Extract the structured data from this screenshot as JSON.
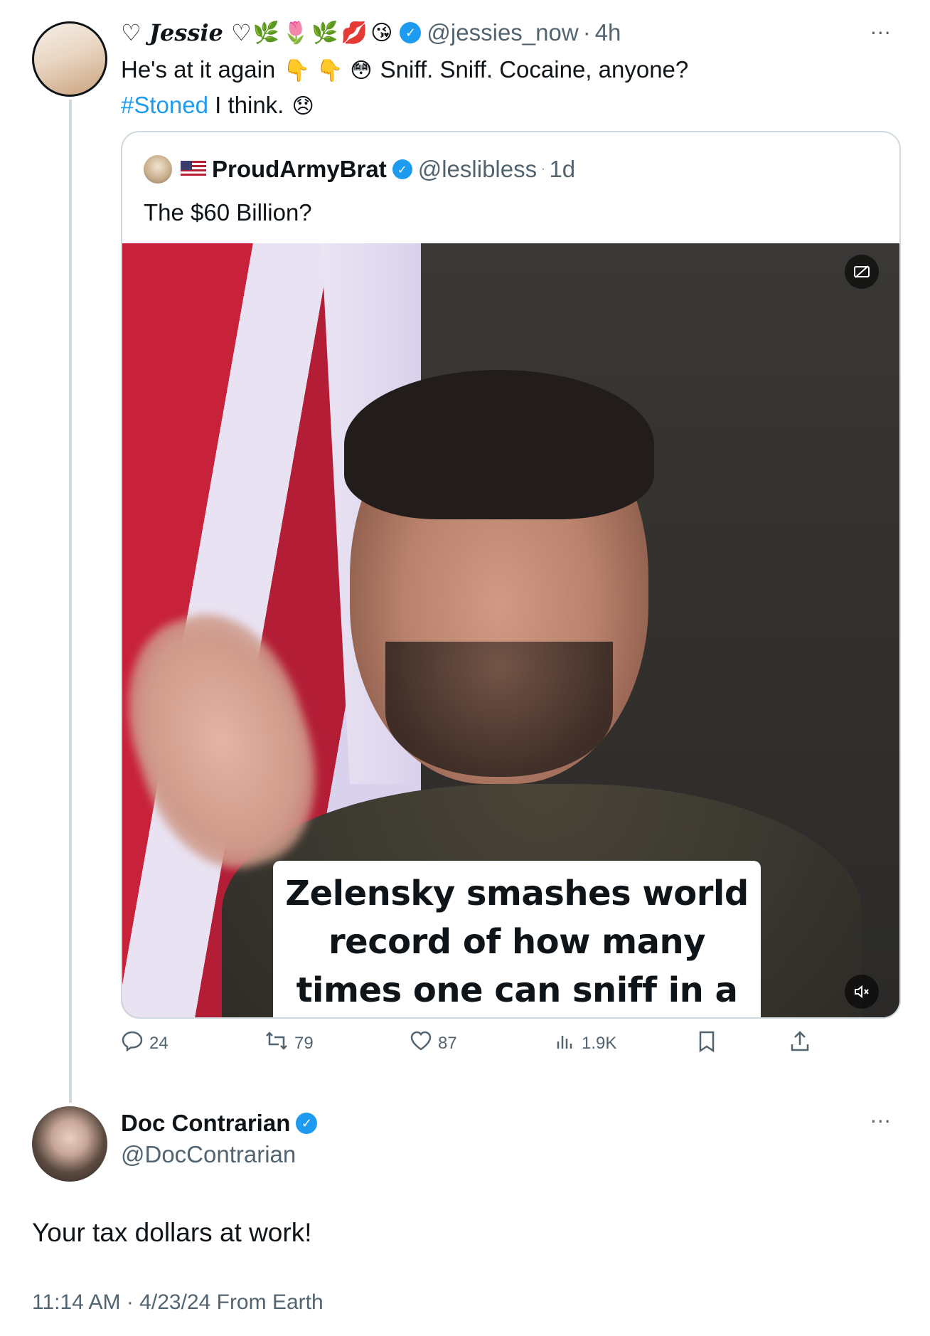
{
  "main_tweet": {
    "display_name": "♡ Jessie ♡",
    "name_emojis": [
      "🌿",
      "🌷",
      "🌿",
      "💋",
      "😘"
    ],
    "handle": "@jessies_now",
    "time": "4h",
    "text_part1": "He's at it again",
    "text_emojis": "👇 👇 😳",
    "text_part2": "Sniff. Sniff. Cocaine, anyone?",
    "hashtag": "#Stoned",
    "text_part3": "I think.",
    "text_emoji_end": "😞",
    "more": "···"
  },
  "quote_tweet": {
    "display_name": "ProudArmyBrat",
    "handle": "@leslibless",
    "time": "1d",
    "text": "The $60 Billion?",
    "video_caption": "Zelensky smashes world record of how many times one can sniff in a press"
  },
  "actions": {
    "replies": "24",
    "reposts": "79",
    "likes": "87",
    "views": "1.9K"
  },
  "reply_tweet": {
    "display_name": "Doc Contrarian",
    "handle": "@DocContrarian",
    "text": "Your tax dollars at work!",
    "timestamp": "11:14 AM · 4/23/24 From Earth",
    "more": "···"
  },
  "icons": {
    "verified": "verified-badge-icon",
    "reply": "reply-icon",
    "repost": "repost-icon",
    "like": "heart-icon",
    "views": "views-icon",
    "bookmark": "bookmark-icon",
    "share": "share-icon",
    "captions": "captions-icon",
    "mute": "mute-icon"
  },
  "colors": {
    "accent": "#1d9bf0",
    "secondary_text": "#536471",
    "border": "#cfd9de"
  }
}
